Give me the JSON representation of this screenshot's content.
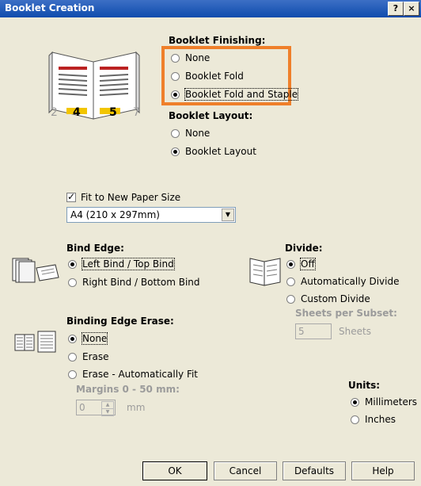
{
  "window": {
    "title": "Booklet Creation",
    "help_glyph": "?",
    "close_glyph": "×"
  },
  "booklet_image": {
    "page_left": "4",
    "page_right": "5",
    "edge_left": "2",
    "edge_right": "7"
  },
  "finishing": {
    "heading": "Booklet Finishing:",
    "options": [
      "None",
      "Booklet Fold",
      "Booklet Fold and Staple"
    ],
    "selected": "Booklet Fold and Staple"
  },
  "layout": {
    "heading": "Booklet Layout:",
    "options": [
      "None",
      "Booklet Layout"
    ],
    "selected": "Booklet Layout"
  },
  "fit": {
    "label": "Fit to New Paper Size",
    "checked": true,
    "paper_size": "A4 (210 x 297mm)",
    "arrow_glyph": "▼"
  },
  "bind_edge": {
    "heading": "Bind Edge:",
    "options": [
      "Left Bind / Top Bind",
      "Right Bind / Bottom Bind"
    ],
    "selected": "Left Bind / Top Bind"
  },
  "divide": {
    "heading": "Divide:",
    "options": [
      "Off",
      "Automatically Divide",
      "Custom Divide"
    ],
    "selected": "Off",
    "sheets_label": "Sheets per Subset:",
    "sheets_value": "5",
    "sheets_unit": "Sheets"
  },
  "erase": {
    "heading": "Binding Edge Erase:",
    "options": [
      "None",
      "Erase",
      "Erase - Automatically Fit"
    ],
    "selected": "None",
    "margins_label": "Margins 0 - 50 mm:",
    "margins_value": "0",
    "margins_unit": "mm"
  },
  "units": {
    "heading": "Units:",
    "options": [
      "Millimeters",
      "Inches"
    ],
    "selected": "Millimeters"
  },
  "buttons": {
    "ok": "OK",
    "cancel": "Cancel",
    "defaults": "Defaults",
    "help": "Help"
  }
}
